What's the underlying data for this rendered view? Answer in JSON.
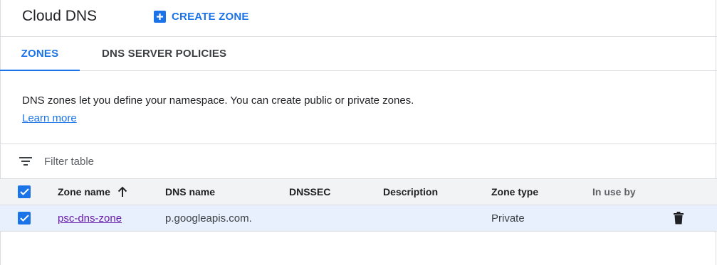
{
  "header": {
    "title": "Cloud DNS",
    "create_zone_label": "CREATE ZONE"
  },
  "tabs": [
    {
      "label": "ZONES",
      "active": true
    },
    {
      "label": "DNS SERVER POLICIES",
      "active": false
    }
  ],
  "info": {
    "text": "DNS zones let you define your namespace. You can create public or private zones.",
    "learn_more": "Learn more"
  },
  "filter": {
    "placeholder": "Filter table"
  },
  "table": {
    "columns": [
      "Zone name",
      "DNS name",
      "DNSSEC",
      "Description",
      "Zone type",
      "In use by"
    ],
    "sorted_column": "Zone name",
    "sort_direction": "ascending",
    "rows": [
      {
        "selected": true,
        "zone_name": "psc-dns-zone",
        "dns_name": "p.googleapis.com.",
        "dnssec": "",
        "description": "",
        "zone_type": "Private",
        "in_use_by": ""
      }
    ]
  },
  "icons": {
    "create": "add-box-icon",
    "filter": "filter-list-icon",
    "sort": "arrow-upward-icon",
    "delete": "trash-icon",
    "checkbox": "check-icon"
  },
  "colors": {
    "accent": "#1a73e8",
    "link_visited": "#681da8",
    "selected_row": "#e8f0fe",
    "header_row": "#f1f3f4"
  }
}
